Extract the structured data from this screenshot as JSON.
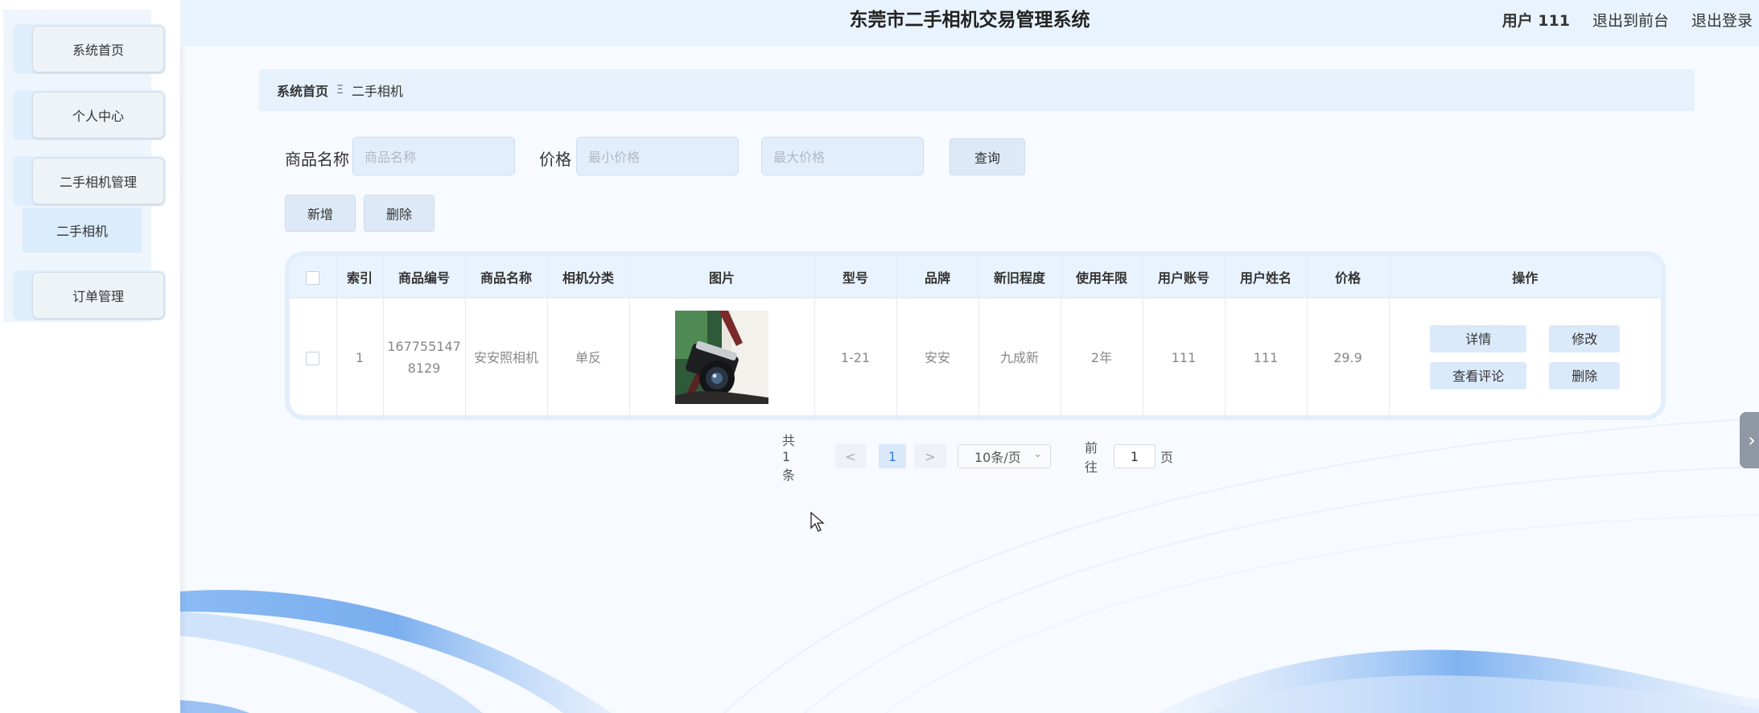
{
  "header": {
    "title": "东莞市二手相机交易管理系统",
    "user_label": "用户 111",
    "front_link": "退出到前台",
    "logout_link": "退出登录"
  },
  "sidebar": {
    "items": [
      {
        "label": "系统首页"
      },
      {
        "label": "个人中心"
      },
      {
        "label": "二手相机管理"
      },
      {
        "label": "订单管理"
      }
    ],
    "submenu": {
      "label": "二手相机"
    }
  },
  "breadcrumb": {
    "home": "系统首页",
    "separator": "Ξ",
    "current": "二手相机"
  },
  "search": {
    "name_label": "商品名称",
    "name_placeholder": "商品名称",
    "price_label": "价格",
    "min_placeholder": "最小价格",
    "max_placeholder": "最大价格",
    "query_button": "查询"
  },
  "actions": {
    "add_button": "新增",
    "delete_button": "删除"
  },
  "table": {
    "columns": [
      "索引",
      "商品编号",
      "商品名称",
      "相机分类",
      "图片",
      "型号",
      "品牌",
      "新旧程度",
      "使用年限",
      "用户账号",
      "用户姓名",
      "价格",
      "操作"
    ],
    "rows": [
      {
        "index": "1",
        "code": "1677551478129",
        "name": "安安照相机",
        "category": "单反",
        "model": "1-21",
        "brand": "安安",
        "condition": "九成新",
        "years": "2年",
        "account": "111",
        "username": "111",
        "price": "29.9",
        "ops": {
          "detail": "详情",
          "edit": "修改",
          "comments": "查看评论",
          "delete": "删除"
        }
      }
    ]
  },
  "pagination": {
    "total": "共 1 条",
    "prev": "<",
    "current_page": "1",
    "next": ">",
    "page_size": "10条/页",
    "goto_label": "前往",
    "goto_value": "1",
    "page_suffix": "页"
  },
  "colors": {
    "accent": "#3d7ed6",
    "header_bg": "#e9f3fd",
    "wave": "#5b9bea"
  }
}
